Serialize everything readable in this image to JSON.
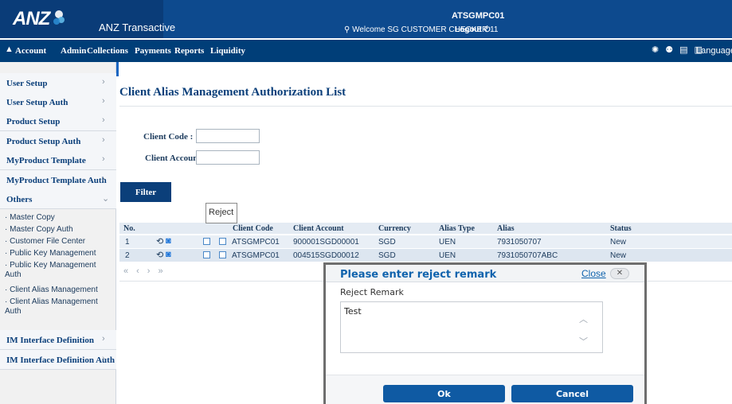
{
  "header": {
    "logo_text": "ANZ",
    "app_name": "ANZ Transactive",
    "user_code": "ATSGMPC01",
    "welcome": "Welcome SG CUSTOMER CHECKER 11",
    "logout": "Logout"
  },
  "nav": {
    "items": [
      "Account",
      "Admin",
      "Collections",
      "Payments",
      "Reports",
      "Liquidity"
    ],
    "language": "Language"
  },
  "sidebar": {
    "items": [
      "User Setup",
      "User Setup Auth",
      "Product Setup",
      "Product Setup Auth",
      "MyProduct Template",
      "MyProduct Template Auth",
      "Others"
    ],
    "others_subitems": [
      "Master Copy",
      "Master Copy Auth",
      "Customer File Center",
      "Public Key Management",
      "Public Key Management Auth",
      "Client Alias Management",
      "Client Alias Management Auth"
    ],
    "bottom_items": [
      "IM Interface Definition",
      "IM Interface Definition Auth"
    ]
  },
  "main": {
    "title": "Client Alias Management Authorization List",
    "client_code_label": "Client Code :",
    "client_account_label": "Client Account :",
    "client_code_value": "",
    "client_account_value": "",
    "filter_label": "Filter",
    "reject_tooltip": "Reject"
  },
  "table": {
    "headers": [
      "No.",
      "Client Code",
      "Client Account",
      "Currency",
      "Alias Type",
      "Alias",
      "Status"
    ],
    "rows": [
      {
        "no": "1",
        "client_code": "ATSGMPC01",
        "client_account": "900001SGD00001",
        "currency": "SGD",
        "alias_type": "UEN",
        "alias": "7931050707",
        "status": "New"
      },
      {
        "no": "2",
        "client_code": "ATSGMPC01",
        "client_account": "004515SGD00012",
        "currency": "SGD",
        "alias_type": "UEN",
        "alias": "7931050707ABC",
        "status": "New"
      }
    ]
  },
  "modal": {
    "title": "Please enter reject remark",
    "close_label": "Close",
    "remark_label": "Reject Remark",
    "remark_value": "Test",
    "ok_label": "Ok",
    "cancel_label": "Cancel"
  }
}
